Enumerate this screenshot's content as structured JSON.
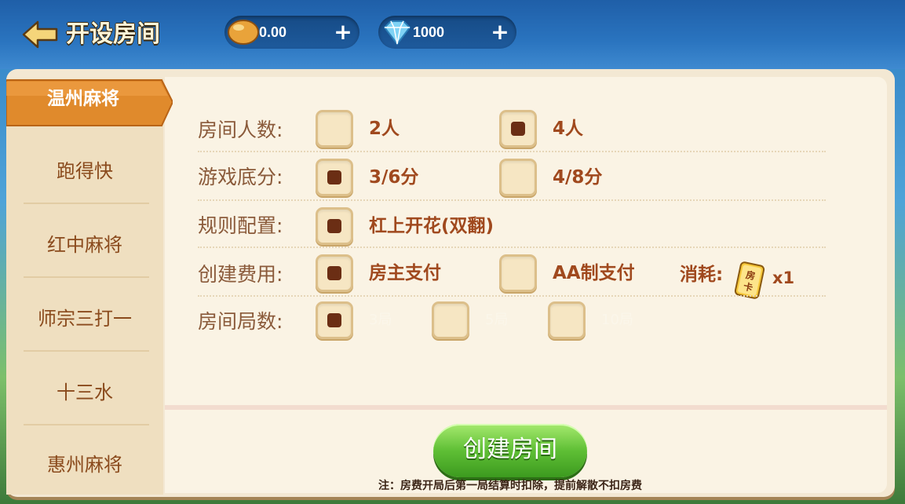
{
  "header": {
    "title": "开设房间",
    "beans": {
      "value": "0.00",
      "icon": "bean-icon"
    },
    "gems": {
      "value": "1000",
      "icon": "diamond-icon"
    },
    "plus_icon": "plus-icon",
    "back_icon": "back-arrow-icon"
  },
  "sidebar": {
    "items": [
      {
        "label": "温州麻将",
        "active": true
      },
      {
        "label": "跑得快",
        "active": false
      },
      {
        "label": "红中麻将",
        "active": false
      },
      {
        "label": "师宗三打一",
        "active": false
      },
      {
        "label": "十三水",
        "active": false
      },
      {
        "label": "惠州麻将",
        "active": false
      }
    ]
  },
  "options": {
    "players": {
      "label": "房间人数:",
      "choices": [
        {
          "text": "2人",
          "checked": false
        },
        {
          "text": "4人",
          "checked": true
        }
      ]
    },
    "base_score": {
      "label": "游戏底分:",
      "choices": [
        {
          "text": "3/6分",
          "checked": true
        },
        {
          "text": "4/8分",
          "checked": false
        }
      ]
    },
    "rules": {
      "label": "规则配置:",
      "choices": [
        {
          "text": "杠上开花(双翻)",
          "checked": true
        }
      ]
    },
    "fee": {
      "label": "创建费用:",
      "choices": [
        {
          "text": "房主支付",
          "checked": true
        },
        {
          "text": "AA制支付",
          "checked": false
        }
      ],
      "consume_label": "消耗:",
      "card_text": "房卡",
      "multiplier": "x1"
    },
    "rounds": {
      "label": "房间局数:",
      "choices": [
        {
          "text": "3局",
          "checked": true
        },
        {
          "text": "5局",
          "checked": false
        },
        {
          "text": "10局",
          "checked": false
        }
      ]
    }
  },
  "create_button": "创建房间",
  "note": "注：房费开局后第一局结算时扣除，提前解散不扣房费",
  "colors": {
    "accent": "#e08a2c",
    "button_green": "#5fbf35",
    "text_brown": "#a0491e"
  }
}
